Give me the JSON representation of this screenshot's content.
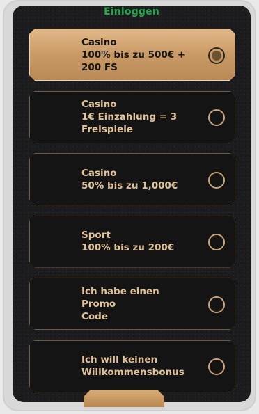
{
  "header": {
    "login_label": "Einloggen"
  },
  "options": [
    {
      "label": "Casino\n100% bis zu 500€ +\n200 FS",
      "selected": true
    },
    {
      "label": "Casino\n1€ Einzahlung = 3\nFreispiele",
      "selected": false
    },
    {
      "label": "Casino\n50% bis zu 1,000€",
      "selected": false
    },
    {
      "label": "Sport\n100% bis zu 200€",
      "selected": false
    },
    {
      "label": "Ich habe einen Promo\nCode",
      "selected": false
    },
    {
      "label": "Ich will keinen\nWillkommensbonus",
      "selected": false
    }
  ],
  "colors": {
    "accent": "#d4a46b",
    "login": "#1fa84a"
  }
}
